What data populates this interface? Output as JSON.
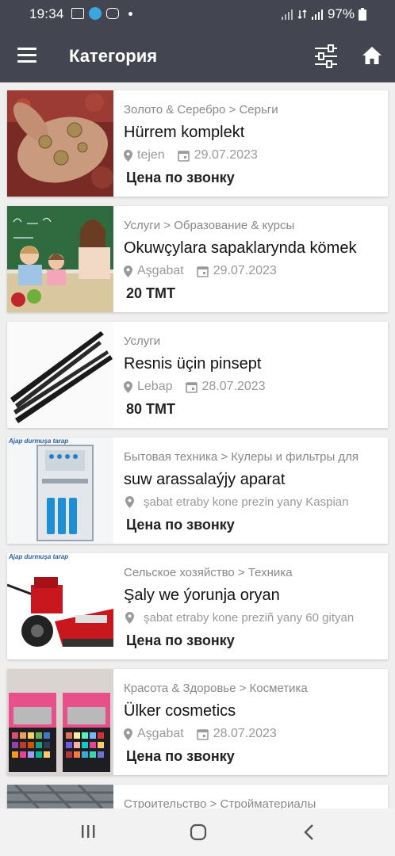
{
  "status": {
    "time": "19:34",
    "battery": "97%"
  },
  "app": {
    "title": "Категория",
    "menu_icon": "menu-icon",
    "filter_icon": "filter-icon",
    "home_icon": "home-icon"
  },
  "listings": [
    {
      "category": "Золото & Серебро > Серьги",
      "title": "Hürrem komplekt",
      "location": "tejen",
      "date": "29.07.2023",
      "price": "Цена по звонку",
      "image": "jewelry-hand"
    },
    {
      "category": "Услуги > Образование & курсы",
      "title": "Okuwçylara sapaklarynda kömek",
      "location": "Aşgabat",
      "date": "29.07.2023",
      "price": "20 TMT",
      "image": "classroom"
    },
    {
      "category": "Услуги",
      "title": "Resnis üçin pinsept",
      "location": "Lebap",
      "date": "28.07.2023",
      "price": "80 TMT",
      "image": "tweezers"
    },
    {
      "category": "Бытовая техника > Кулеры и фильтры для",
      "title": "suw arassalaýjy aparat",
      "location": "şabat etraby kone prezin yany Kaspian",
      "date": "",
      "price": "Цена по звонку",
      "image": "water-filter",
      "watermark": "Ajap durmuşa tarap"
    },
    {
      "category": "Сельское хозяйство > Техника",
      "title": "Şaly we ýorunja oryan",
      "location": "şabat etraby kone preziñ yany 60 gityan",
      "date": "",
      "price": "Цена по звонку",
      "image": "harvester",
      "watermark": "Ajap durmuşa tarap"
    },
    {
      "category": "Красота & Здоровье > Косметика",
      "title": "Ülker cosmetics",
      "location": "Aşgabat",
      "date": "28.07.2023",
      "price": "Цена по звонку",
      "image": "eyeshadow"
    },
    {
      "category": "Строительство > Стройматериалы",
      "title": "",
      "location": "",
      "date": "",
      "price": "",
      "image": "metal"
    }
  ]
}
